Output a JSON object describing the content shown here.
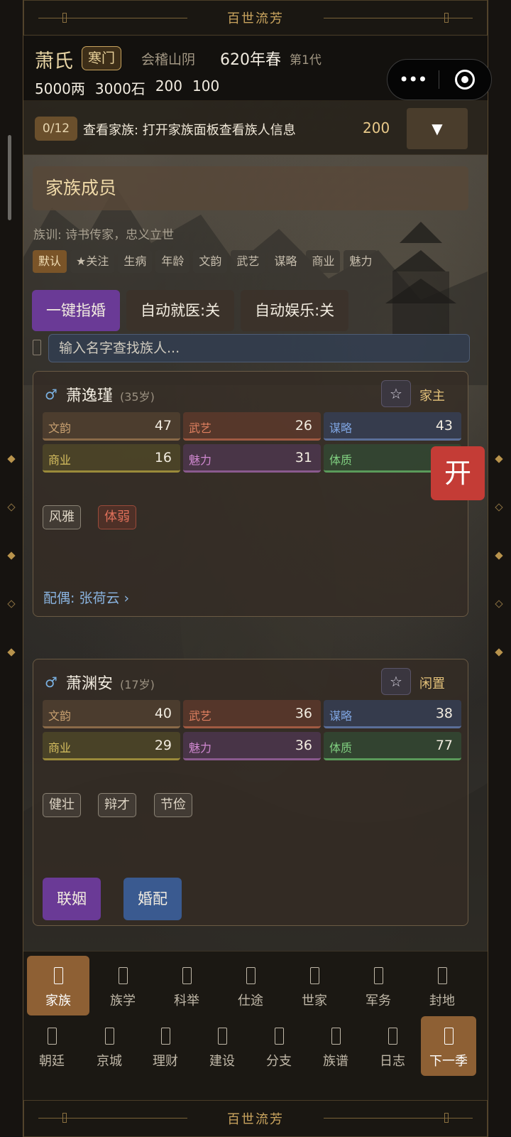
{
  "banner": {
    "title": "百世流芳"
  },
  "header": {
    "clan_name": "萧氏",
    "rank": "寒门",
    "location": "会稽山阴",
    "year": "620年春",
    "generation": "第1代",
    "resources": [
      "5000两",
      "3000石",
      "200",
      "100"
    ]
  },
  "quest": {
    "progress": "0/12",
    "text": "查看家族: 打开家族面板查看族人信息",
    "reward": "200",
    "expand": "▼"
  },
  "family": {
    "section_title": "家族成员",
    "motto": "族训: 诗书传家，忠义立世",
    "filters": [
      "默认",
      "★关注",
      "生病",
      "年龄",
      "文韵",
      "武艺",
      "谋略",
      "商业",
      "魅力"
    ],
    "actions": [
      "一键指婚",
      "自动就医:关",
      "自动娱乐:关"
    ],
    "search_placeholder": "输入名字查找族人..."
  },
  "members": [
    {
      "gender_icon": "♂",
      "name": "萧逸瑾",
      "age": "(35岁)",
      "star": "☆",
      "role": "家主",
      "stats": {
        "wen": {
          "label": "文韵",
          "value": "47"
        },
        "wu": {
          "label": "武艺",
          "value": "26"
        },
        "mou": {
          "label": "谋略",
          "value": "43"
        },
        "shang": {
          "label": "商业",
          "value": "16"
        },
        "mei": {
          "label": "魅力",
          "value": "31"
        },
        "ti": {
          "label": "体质",
          "value": ""
        }
      },
      "traits": [
        "风雅",
        "体弱"
      ],
      "spouse": "配偶: 张荷云 ›"
    },
    {
      "gender_icon": "♂",
      "name": "萧渊安",
      "age": "(17岁)",
      "star": "☆",
      "role": "闲置",
      "stats": {
        "wen": {
          "label": "文韵",
          "value": "40"
        },
        "wu": {
          "label": "武艺",
          "value": "36"
        },
        "mou": {
          "label": "谋略",
          "value": "38"
        },
        "shang": {
          "label": "商业",
          "value": "29"
        },
        "mei": {
          "label": "魅力",
          "value": "36"
        },
        "ti": {
          "label": "体质",
          "value": "77"
        }
      },
      "traits": [
        "健壮",
        "辩才",
        "节俭"
      ],
      "buttons": [
        "联姻",
        "婚配"
      ]
    }
  ],
  "open_badge": "开",
  "nav": {
    "row1": [
      "家族",
      "族学",
      "科举",
      "仕途",
      "世家",
      "军务",
      "封地"
    ],
    "row2": [
      "朝廷",
      "京城",
      "理财",
      "建设",
      "分支",
      "族谱",
      "日志",
      "下一季"
    ]
  },
  "colors": {
    "accent_gold": "#c9a45e",
    "primary_purple": "#6a3a96",
    "secondary_blue": "#3a5a90",
    "badge_red": "#c43c36",
    "nav_active": "#8e6034"
  }
}
